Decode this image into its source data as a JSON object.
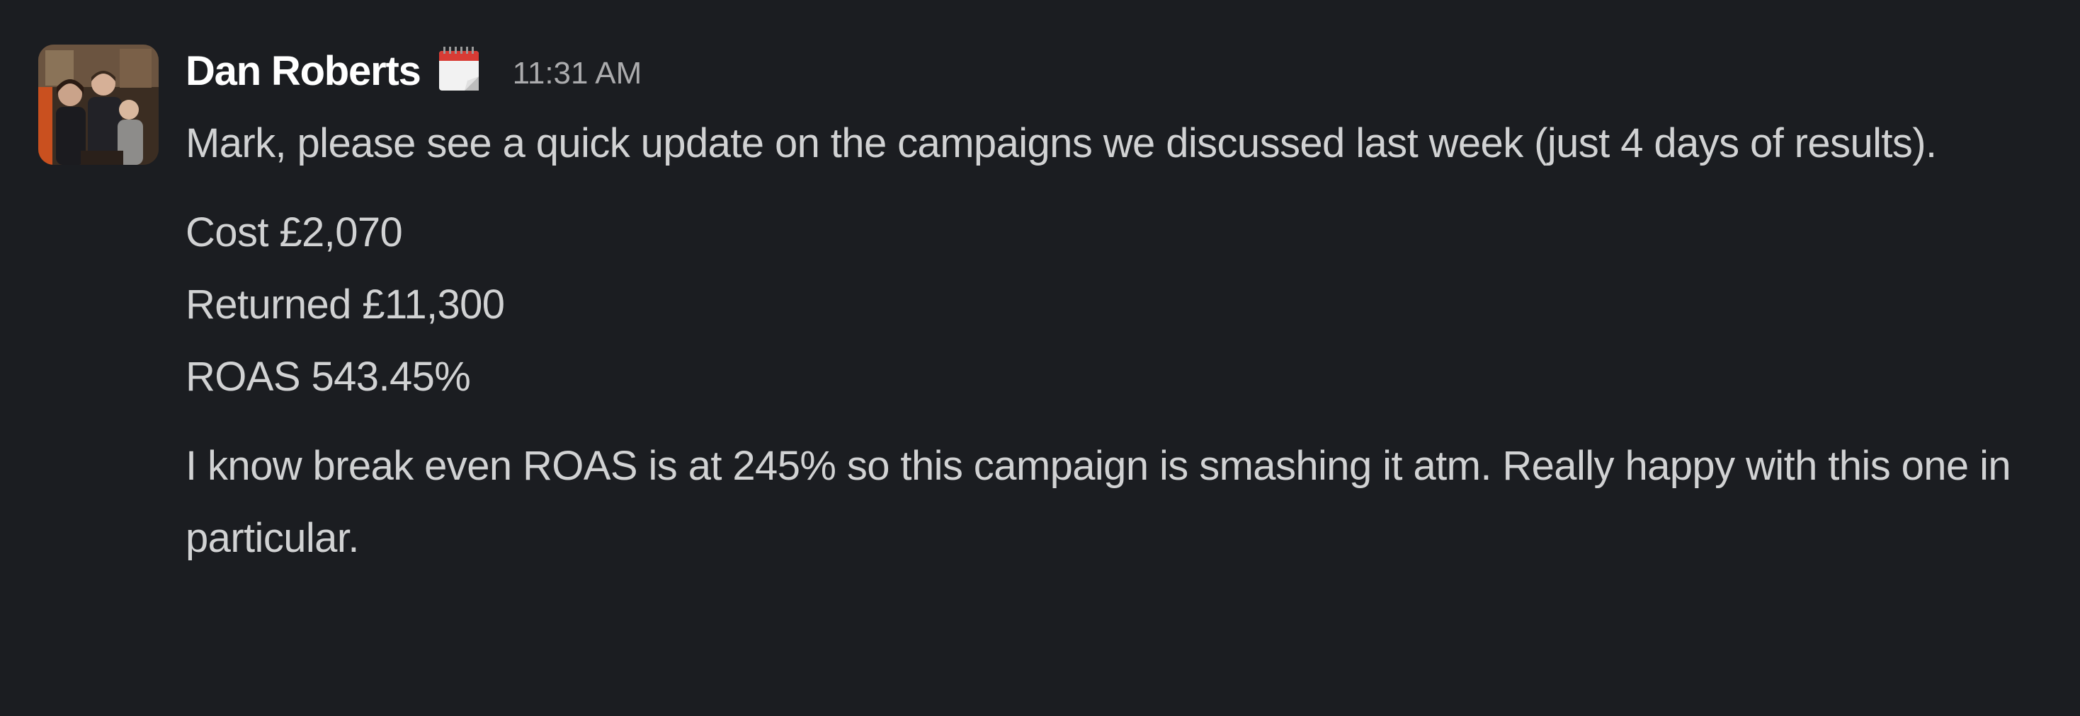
{
  "message": {
    "author": "Dan Roberts",
    "status_icon": "calendar-icon",
    "timestamp": "11:31 AM",
    "paragraph_1": "Mark, please see a quick update on the campaigns we discussed last week (just 4 days of results).",
    "stats": [
      "Cost £2,070",
      "Returned £11,300",
      "ROAS 543.45%"
    ],
    "paragraph_2": "I know break even ROAS is at 245% so this campaign is smashing it atm. Really happy with this one in particular."
  },
  "colors": {
    "background": "#1b1d21",
    "text": "#d1d2d3",
    "author": "#ffffff",
    "timestamp": "#ababad"
  }
}
